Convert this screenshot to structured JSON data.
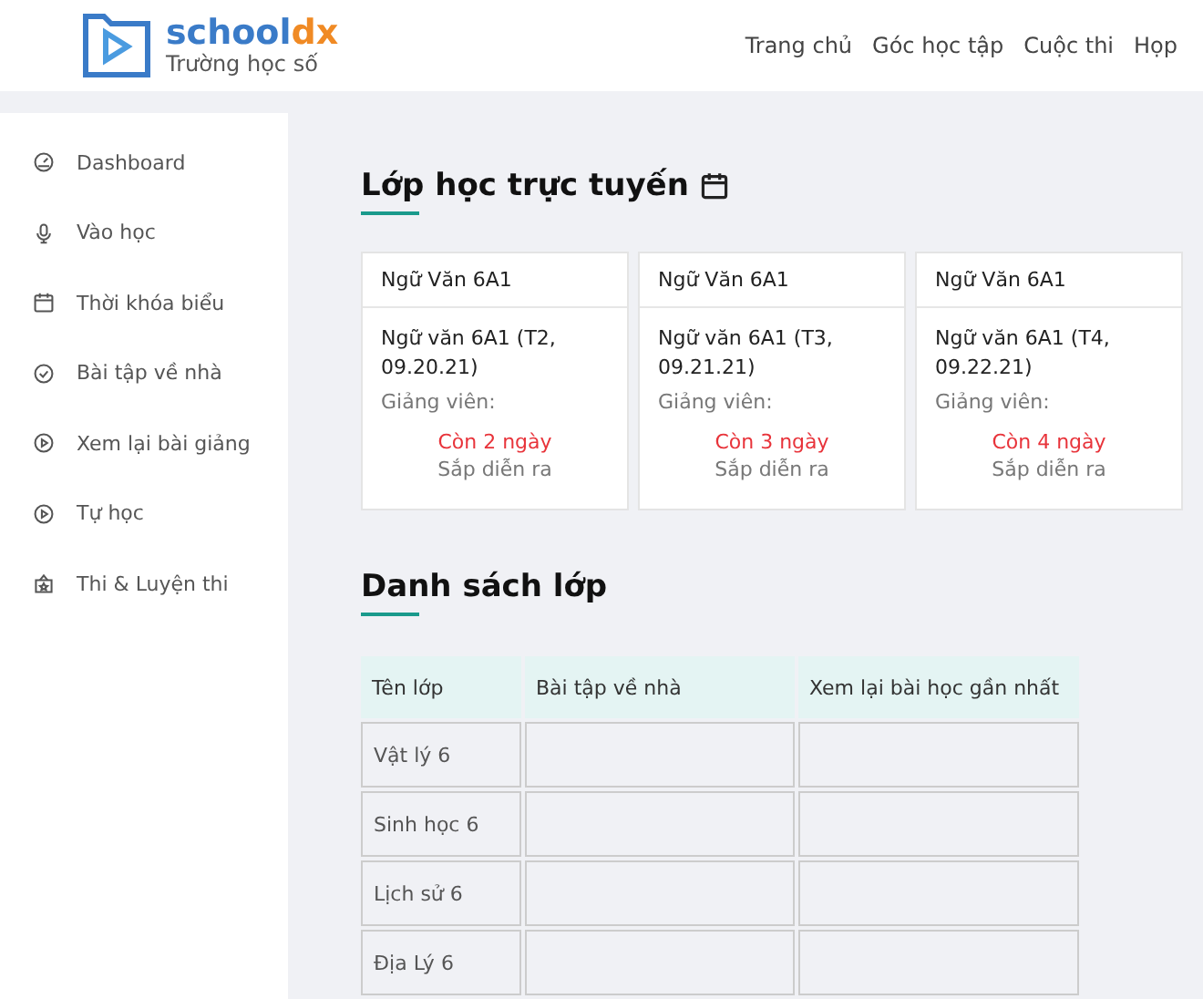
{
  "logo": {
    "wordmark": [
      "school",
      "dx"
    ],
    "tagline": "Trường học số"
  },
  "nav": [
    "Trang chủ",
    "Góc học tập",
    "Cuộc thi",
    "Họp"
  ],
  "sidebar": {
    "items": [
      {
        "label": "Dashboard"
      },
      {
        "label": "Vào học"
      },
      {
        "label": "Thời khóa biểu"
      },
      {
        "label": "Bài tập về nhà"
      },
      {
        "label": "Xem lại bài giảng"
      },
      {
        "label": "Tự học"
      },
      {
        "label": "Thi & Luyện thi"
      }
    ]
  },
  "online_classes": {
    "title": "Lớp học trực tuyến",
    "cards": [
      {
        "subject": "Ngữ Văn 6A1",
        "session": "Ngữ văn 6A1 (T2, 09.20.21)",
        "teacher_label": "Giảng viên:",
        "countdown": "Còn 2 ngày",
        "status": "Sắp diễn ra"
      },
      {
        "subject": "Ngữ Văn 6A1",
        "session": "Ngữ văn 6A1 (T3, 09.21.21)",
        "teacher_label": "Giảng viên:",
        "countdown": "Còn 3 ngày",
        "status": "Sắp diễn ra"
      },
      {
        "subject": "Ngữ Văn 6A1",
        "session": "Ngữ văn 6A1 (T4, 09.22.21)",
        "teacher_label": "Giảng viên:",
        "countdown": "Còn 4 ngày",
        "status": "Sắp diễn ra"
      }
    ]
  },
  "class_list": {
    "title": "Danh sách lớp",
    "columns": [
      "Tên lớp",
      "Bài tập về nhà",
      "Xem lại bài học gần nhất"
    ],
    "rows": [
      {
        "name": "Vật lý 6"
      },
      {
        "name": "Sinh học 6"
      },
      {
        "name": "Lịch sử 6"
      },
      {
        "name": "Địa Lý 6"
      }
    ]
  }
}
